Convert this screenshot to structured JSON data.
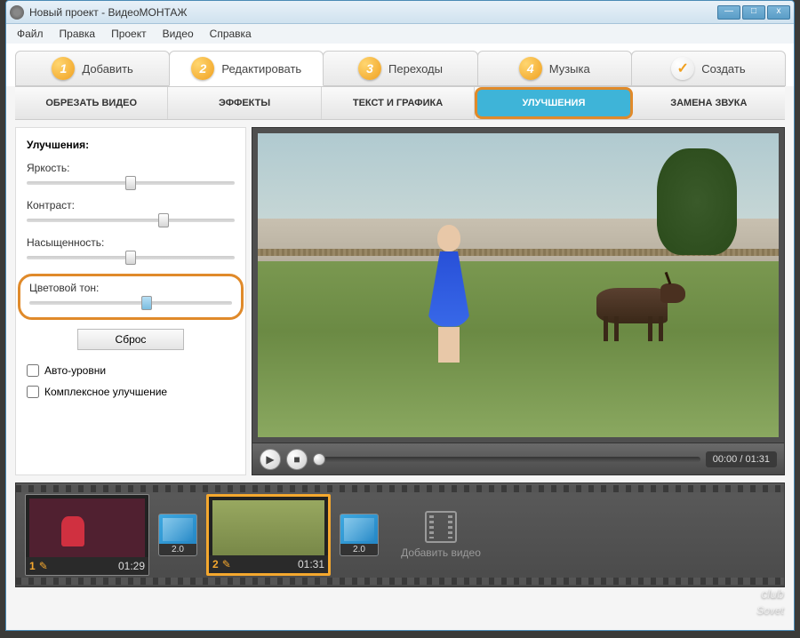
{
  "window": {
    "title": "Новый проект - ВидеоМОНТАЖ"
  },
  "menu": {
    "file": "Файл",
    "edit": "Правка",
    "project": "Проект",
    "video": "Видео",
    "help": "Справка"
  },
  "main_tabs": {
    "add": "Добавить",
    "edit": "Редактировать",
    "transitions": "Переходы",
    "music": "Музыка",
    "create": "Создать",
    "nums": {
      "t1": "1",
      "t2": "2",
      "t3": "3",
      "t4": "4"
    }
  },
  "sub_tabs": {
    "trim": "ОБРЕЗАТЬ ВИДЕО",
    "effects": "ЭФФЕКТЫ",
    "text": "ТЕКСТ И ГРАФИКА",
    "enhance": "УЛУЧШЕНИЯ",
    "replace_audio": "ЗАМЕНА ЗВУКА"
  },
  "enhance_panel": {
    "heading": "Улучшения:",
    "brightness": {
      "label": "Яркость:",
      "value": 50
    },
    "contrast": {
      "label": "Контраст:",
      "value": 66
    },
    "saturation": {
      "label": "Насыщенность:",
      "value": 50
    },
    "hue": {
      "label": "Цветовой тон:",
      "value": 58
    },
    "reset": "Сброс",
    "auto_levels": "Авто-уровни",
    "complex": "Комплексное улучшение"
  },
  "player": {
    "time": "00:00 / 01:31"
  },
  "timeline": {
    "clip1": {
      "index": "1",
      "duration": "01:29"
    },
    "trans1": {
      "duration": "2.0"
    },
    "clip2": {
      "index": "2",
      "duration": "01:31"
    },
    "trans2": {
      "duration": "2.0"
    },
    "add_label": "Добавить видео"
  },
  "watermark": {
    "line1": "club",
    "line2": "Sovet"
  }
}
